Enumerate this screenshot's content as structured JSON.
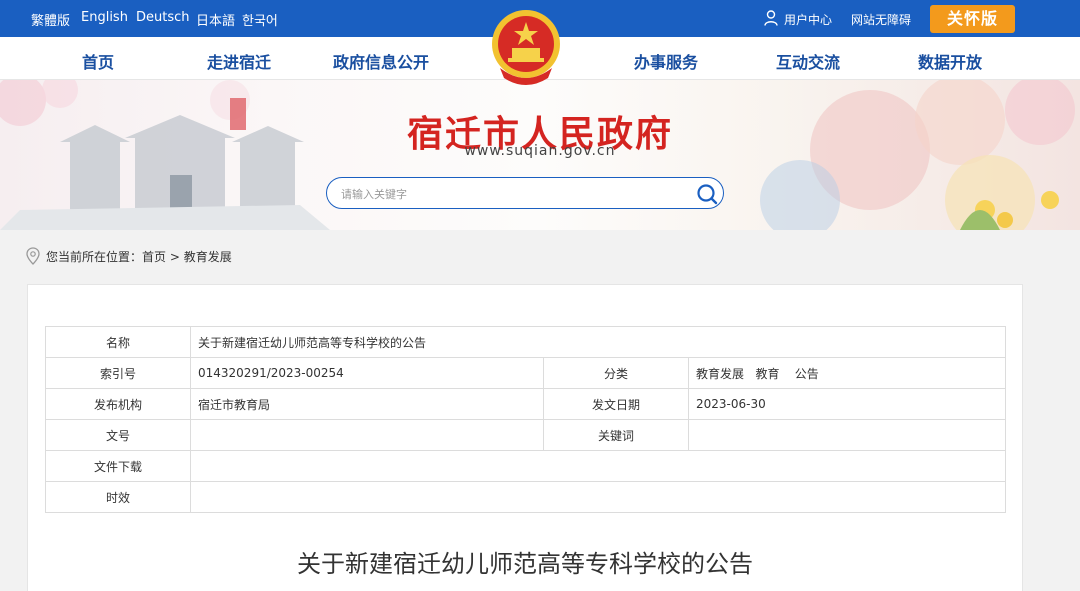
{
  "topbar": {
    "languages": [
      "繁體版",
      "English",
      "Deutsch",
      "日本語",
      "한국어"
    ],
    "user_center": "用户中心",
    "accessibility": "网站无障碍",
    "care_mode": "关怀版"
  },
  "nav": {
    "items": [
      "首页",
      "走进宿迁",
      "政府信息公开",
      "办事服务",
      "互动交流",
      "数据开放"
    ]
  },
  "banner": {
    "title": "宿迁市人民政府",
    "url": "www.suqian.gov.cn",
    "search_placeholder": "请输入关键字"
  },
  "breadcrumb": {
    "prefix": "您当前所在位置：",
    "items": [
      "首页",
      "教育发展"
    ],
    "separator": ">"
  },
  "meta": {
    "name_label": "名称",
    "name_value": "关于新建宿迁幼儿师范高等专科学校的公告",
    "index_label": "索引号",
    "index_value": "014320291/2023-00254",
    "category_label": "分类",
    "category_value": "教育发展   教育    公告",
    "publisher_label": "发布机构",
    "publisher_value": "宿迁市教育局",
    "date_label": "发文日期",
    "date_value": "2023-06-30",
    "doc_no_label": "文号",
    "doc_no_value": "",
    "keywords_label": "关键词",
    "keywords_value": "",
    "download_label": "文件下载",
    "download_value": "",
    "validity_label": "时效",
    "validity_value": ""
  },
  "article": {
    "title": "关于新建宿迁幼儿师范高等专科学校的公告"
  },
  "colors": {
    "primary_blue": "#1a5fc1",
    "nav_text": "#1a4fa0",
    "title_red": "#d42420",
    "care_orange": "#f39a1c"
  }
}
